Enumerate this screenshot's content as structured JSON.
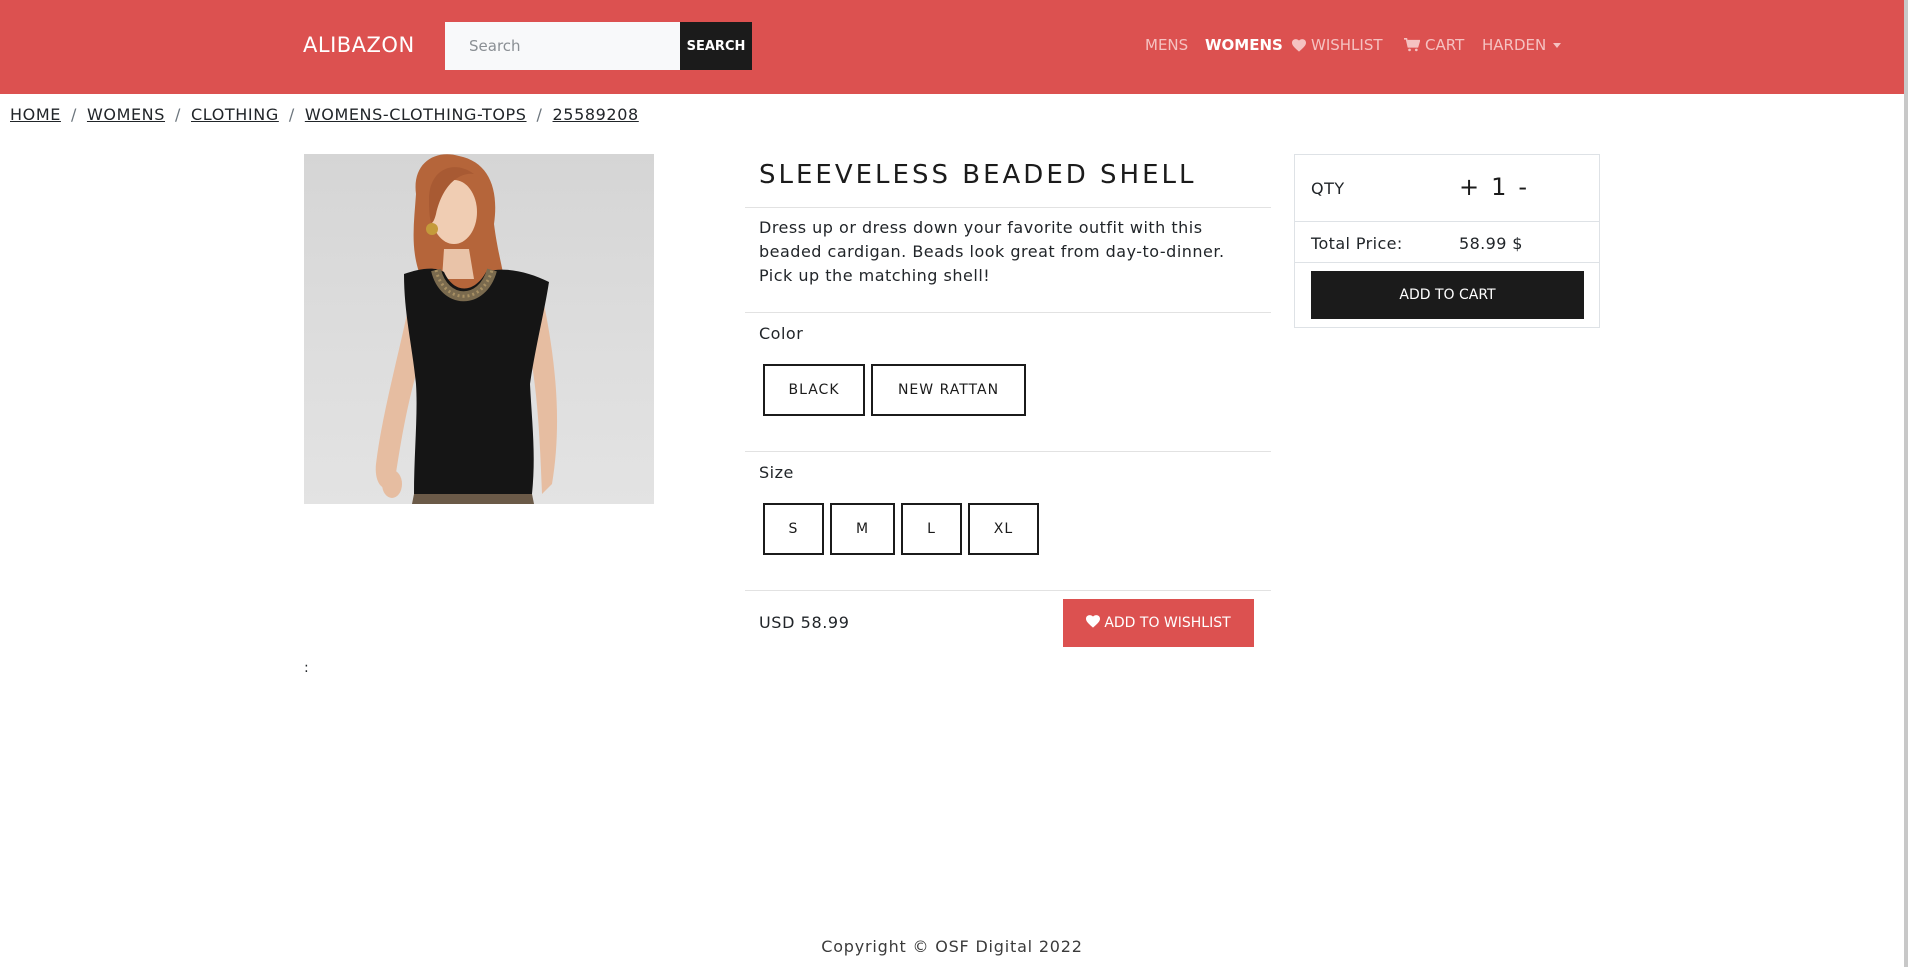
{
  "navbar": {
    "brand": "ALIBAZON",
    "search_placeholder": "Search",
    "search_button": "SEARCH",
    "links": {
      "mens": "MENS",
      "womens": "WOMENS",
      "wishlist": "WISHLIST",
      "cart": "CART",
      "user": "HARDEN"
    },
    "colors": {
      "bar": "#dc5150",
      "link": "#f5c2c1",
      "active": "#ffffff"
    }
  },
  "breadcrumb": {
    "items": [
      "HOME",
      "WOMENS",
      "CLOTHING",
      "WOMENS-CLOTHING-TOPS",
      "25589208"
    ],
    "separator": "/"
  },
  "product": {
    "title": "SLEEVELESS BEADED SHELL",
    "description": "Dress up or dress down your favorite outfit with this beaded cardigan. Beads look great from day-to-dinner. Pick up the matching shell!",
    "color_label": "Color",
    "colors": [
      "BLACK",
      "NEW RATTAN"
    ],
    "size_label": "Size",
    "sizes": [
      "S",
      "M",
      "L",
      "XL"
    ],
    "price": "USD 58.99",
    "wishlist_button": "ADD TO WISHLIST",
    "image_icon": "model-in-black-sleeveless-top-photo",
    "colon_text": ":"
  },
  "cart_panel": {
    "qty_label": "QTY",
    "qty_plus": "+",
    "qty_value": "1",
    "qty_minus": "-",
    "total_label": "Total Price:",
    "total_value": "58.99 $",
    "add_to_cart": "ADD TO CART"
  },
  "footer": {
    "copyright": "Copyright © OSF Digital 2022"
  }
}
